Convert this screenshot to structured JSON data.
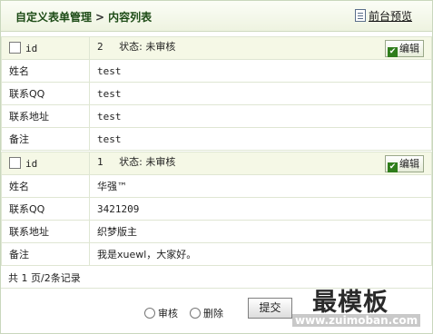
{
  "header": {
    "crumb_root": "自定义表单管理",
    "crumb_sep": ">",
    "crumb_current": "内容列表",
    "preview_label": "前台预览"
  },
  "records": [
    {
      "id_label": "id",
      "id": "2",
      "status": "状态: 未审核",
      "edit_label": "编辑",
      "fields": [
        {
          "label": "姓名",
          "value": "test"
        },
        {
          "label": "联系QQ",
          "value": "test"
        },
        {
          "label": "联系地址",
          "value": "test"
        },
        {
          "label": "备注",
          "value": "test"
        }
      ]
    },
    {
      "id_label": "id",
      "id": "1",
      "status": "状态: 未审核",
      "edit_label": "编辑",
      "fields": [
        {
          "label": "姓名",
          "value": "华强™"
        },
        {
          "label": "联系QQ",
          "value": "3421209"
        },
        {
          "label": "联系地址",
          "value": "织梦版主"
        },
        {
          "label": "备注",
          "value": "我是xuewl，大家好。"
        }
      ]
    }
  ],
  "footer": {
    "summary": "共 1 页/2条记录"
  },
  "actions": {
    "approve_label": "审核",
    "delete_label": "删除",
    "submit_label": "提交"
  },
  "watermark": {
    "text": "最模板",
    "url": "www.zuimoban.com"
  },
  "colors": {
    "header_bg": "#eef3e0",
    "title_text": "#1d4b16",
    "row_head_bg": "#f5f8e6",
    "border": "#dfe6d3"
  }
}
